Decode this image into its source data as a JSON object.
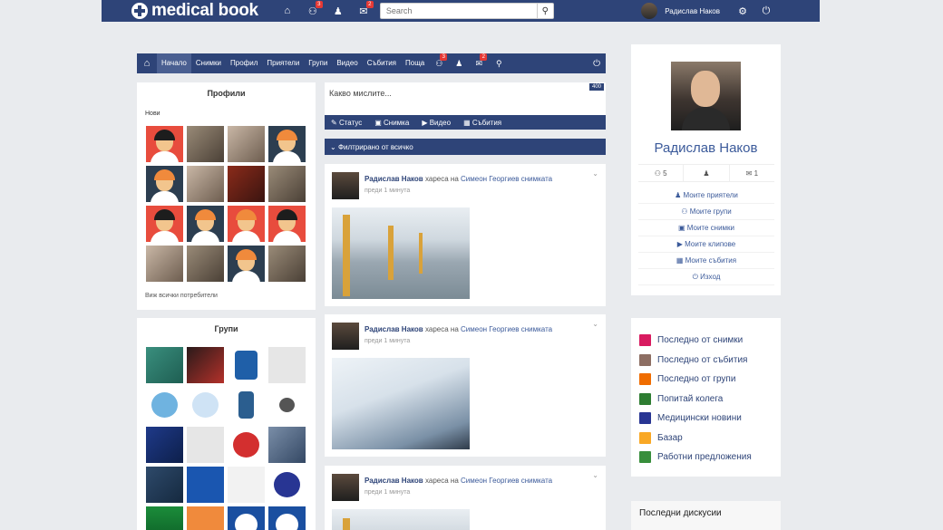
{
  "topbar": {
    "logo": "medical book",
    "badges": {
      "groups": "3",
      "messages": "2"
    },
    "search_placeholder": "Search",
    "user_name": "Радислав Наков"
  },
  "mainnav": {
    "items": [
      "Начало",
      "Снимки",
      "Профил",
      "Приятели",
      "Групи",
      "Видео",
      "Събития",
      "Поща"
    ],
    "badges": {
      "groups": "3",
      "mail": "2"
    }
  },
  "profiles": {
    "title": "Профили",
    "new_label": "Нови",
    "see_all": "Виж всички потребители"
  },
  "groups": {
    "title": "Групи"
  },
  "status": {
    "placeholder": "Какво мислите...",
    "char_count": "400",
    "tabs": [
      "Статус",
      "Снимка",
      "Видео",
      "Събития"
    ]
  },
  "filter": {
    "label": "Филтрирано от всичко"
  },
  "posts": [
    {
      "name": "Радислав Наков",
      "verb": "харесa на",
      "target": "Симеон Георгиев снимката",
      "time": "преди 1 минута"
    },
    {
      "name": "Радислав Наков",
      "verb": "харесa на",
      "target": "Симеон Георгиев снимката",
      "time": "преди 1 минута"
    },
    {
      "name": "Радислав Наков",
      "verb": "харесa на",
      "target": "Симеон Георгиев снимката",
      "time": "преди 1 минута"
    }
  ],
  "user_card": {
    "name": "Радислав Наков",
    "stats": {
      "groups": "5",
      "messages": "1"
    },
    "links": [
      "Моите приятели",
      "Моите групи",
      "Моите снимки",
      "Моите клипове",
      "Моите събития",
      "Изход"
    ]
  },
  "latest": {
    "items": [
      {
        "label": "Последно от снимки",
        "color": "#d81b60"
      },
      {
        "label": "Последно от събития",
        "color": "#8d6e63"
      },
      {
        "label": "Последно от групи",
        "color": "#ef6c00"
      },
      {
        "label": "Попитай колега",
        "color": "#2e7d32"
      },
      {
        "label": "Медицински новини",
        "color": "#283593"
      },
      {
        "label": "Базар",
        "color": "#f9a825"
      },
      {
        "label": "Работни предложения",
        "color": "#388e3c"
      }
    ]
  },
  "discussions": {
    "title": "Последни дискусии"
  },
  "icons": {
    "home": "home-icon",
    "groups": "users-icon",
    "friend": "user-icon",
    "mail": "envelope-icon",
    "search": "search-icon",
    "settings": "gear-icon",
    "power": "power-icon"
  }
}
